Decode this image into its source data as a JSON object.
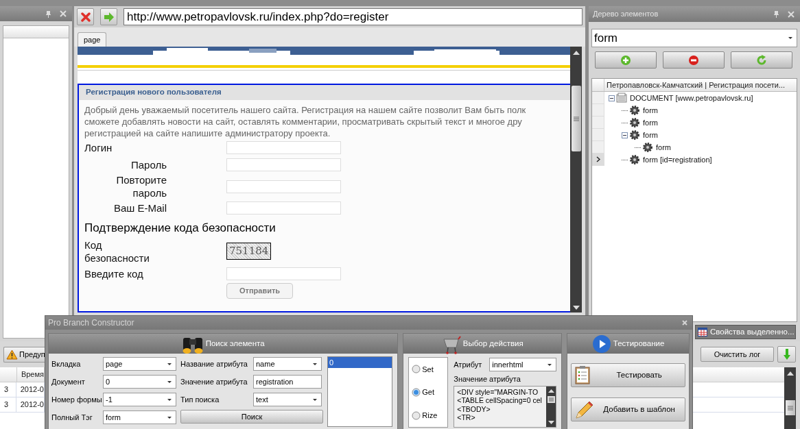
{
  "browser": {
    "url": "http://www.petropavlovsk.ru/index.php?do=register",
    "tabs": [
      {
        "label": "page",
        "selected": true
      }
    ],
    "page": {
      "title": "Регистрация нового пользователя",
      "intro": [
        "Добрый день уважаемый посетитель нашего сайта. Регистрация на нашем сайте позволит Вам быть полк",
        "сможете добавлять новости на сайт, оставлять комментарии, просматривать скрытый текст и многое дру",
        "регистрацией на сайте напишите администратору проекта."
      ],
      "fields": [
        {
          "label": "Логин",
          "kind": "flush"
        },
        {
          "label": "Пароль",
          "kind": "indented"
        },
        {
          "label": "Повторите пароль",
          "kind": "indented"
        },
        {
          "label": "Ваш E-Mail",
          "kind": "indented"
        }
      ],
      "security_heading": "Подтверждение кода безопасности",
      "captcha_label": "Код безопасности",
      "captcha_code": "751184",
      "code_label": "Введите код",
      "submit": "Отправить"
    }
  },
  "element_tree": {
    "title": "Дерево элементов",
    "filter": "form",
    "header": "Петропавловск-Камчатский | Регистрация посети...",
    "nodes": [
      {
        "label": "DOCUMENT [www.petropavlovsk.ru]",
        "kind": "document",
        "expanded": true,
        "selected": false,
        "children": [
          {
            "label": "form",
            "kind": "element",
            "selected": false
          },
          {
            "label": "form",
            "kind": "element",
            "selected": false
          },
          {
            "label": "form",
            "kind": "element",
            "expanded": true,
            "selected": false,
            "children": [
              {
                "label": "form",
                "kind": "element",
                "selected": false
              }
            ]
          },
          {
            "label": "form [id=registration]",
            "kind": "element",
            "selected": true
          }
        ]
      }
    ],
    "bottom_tab": "Свойства выделенно..."
  },
  "log": {
    "filter_button": "Предуп",
    "columns": [
      "",
      "Время"
    ],
    "rows": [
      [
        "3",
        "2012-0"
      ],
      [
        "3",
        "2012-0"
      ]
    ],
    "clear_button": "Очистить лог"
  },
  "dialog": {
    "title": "Pro Branch Constructor",
    "search": {
      "title": "Поиск элемента",
      "left_fields": [
        {
          "label": "Вкладка",
          "value": "page",
          "kind": "combo"
        },
        {
          "label": "Документ",
          "value": "0",
          "kind": "combo"
        },
        {
          "label": "Номер формы",
          "value": "-1",
          "kind": "combo"
        },
        {
          "label": "Полный Тэг",
          "value": "form",
          "kind": "combo"
        }
      ],
      "right_fields": [
        {
          "label": "Название атрибута",
          "value": "name",
          "kind": "combo"
        },
        {
          "label": "Значение атрибута",
          "value": "registration",
          "kind": "text"
        },
        {
          "label": "Тип поиска",
          "value": "text",
          "kind": "combo"
        }
      ],
      "button": "Поиск",
      "results": [
        {
          "label": "0",
          "selected": true
        }
      ]
    },
    "action": {
      "title": "Выбор действия",
      "modes": [
        {
          "label": "Set",
          "selected": false
        },
        {
          "label": "Get",
          "selected": true
        },
        {
          "label": "Rize",
          "selected": false
        }
      ],
      "attribute_label": "Атрибут",
      "attribute": "innerhtml",
      "value_label": "Значение атрибута",
      "value_lines": [
        "<DIV style=\"MARGIN-TO",
        "<TABLE cellSpacing=0 cel",
        "<TBODY>",
        "<TR>"
      ]
    },
    "testing": {
      "title": "Тестирование",
      "buttons": [
        {
          "label": "Тестировать",
          "kind": "test"
        },
        {
          "label": "Добавить в шаблон",
          "kind": "template"
        }
      ]
    }
  }
}
